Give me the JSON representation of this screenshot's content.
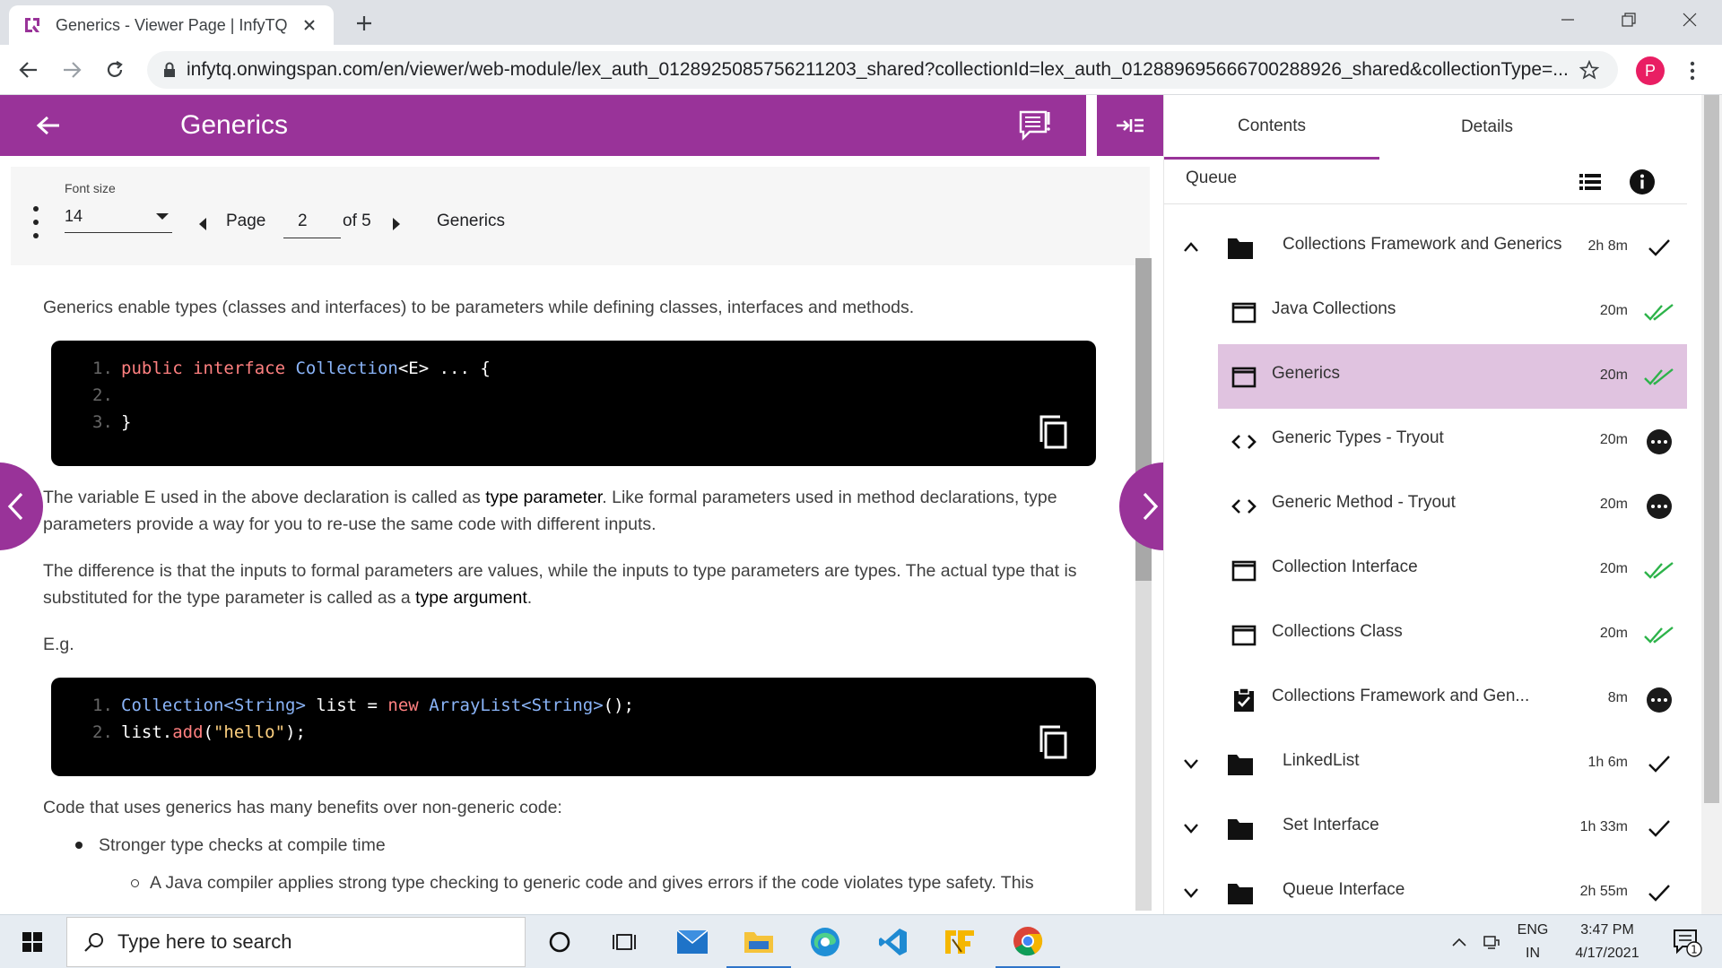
{
  "browser": {
    "tab_title": "Generics - Viewer Page | InfyTQ",
    "url": "infytq.onwingspan.com/en/viewer/web-module/lex_auth_0128925085756211203_shared?collectionId=lex_auth_0128896956667002889​26_shared&collectionType=...",
    "profile_initial": "P"
  },
  "header": {
    "title": "Generics"
  },
  "toolbar": {
    "font_size_label": "Font size",
    "font_size_value": "14",
    "page_label": "Page",
    "page_current": "2",
    "page_of": "of 5",
    "section_title": "Generics"
  },
  "content": {
    "p1": "Generics enable types (classes and interfaces) to be parameters while defining classes, interfaces and methods.",
    "code1": {
      "l1_num": "1.",
      "l1_kw": "public interface ",
      "l1_ty": "Collection",
      "l1_pl": "<E> ... {",
      "l2_num": "2.",
      "l3_num": "3.",
      "l3_pl": "}"
    },
    "p2_a": "The variable E used in the above declaration is called as ",
    "p2_b": "type parameter",
    "p2_c": ". Like formal parameters used in method declarations, type parameters provide a way for you to re-use the same code with different inputs.",
    "p3_a": "The difference is that the inputs to formal parameters are values, while the inputs to type parameters are types. The actual type that is substituted for the type parameter is called as a ",
    "p3_b": "type argument",
    "p3_c": ".",
    "p4": "E.g.",
    "code2": {
      "l1_num": "1.",
      "l1_ty1": "Collection<String>",
      "l1_pl1": " list = ",
      "l1_kw": "new ",
      "l1_ty2": "ArrayList<String>",
      "l1_pl2": "();",
      "l2_num": "2.",
      "l2_pl1": "list.",
      "l2_kw": "add",
      "l2_pl2": "(",
      "l2_st": "\"hello\"",
      "l2_pl3": ");"
    },
    "p5": "Code that uses generics has many benefits over non-generic code:",
    "bullet1": "Stronger type checks at compile time",
    "sub_bullet1": "A Java compiler applies strong type checking to generic code and gives errors if the code violates type safety. This"
  },
  "panel": {
    "tabs": [
      "Contents",
      "Details"
    ],
    "queue_label": "Queue",
    "items": [
      {
        "label": "Collections Framework and Generics",
        "duration": "2h 8m",
        "type": "folder",
        "expanded": true,
        "status": "check"
      },
      {
        "label": "Java Collections",
        "duration": "20m",
        "type": "page",
        "status": "double-check"
      },
      {
        "label": "Generics",
        "duration": "20m",
        "type": "page",
        "status": "double-check",
        "active": true
      },
      {
        "label": "Generic Types - Tryout",
        "duration": "20m",
        "type": "code",
        "status": "more"
      },
      {
        "label": "Generic Method - Tryout",
        "duration": "20m",
        "type": "code",
        "status": "more"
      },
      {
        "label": "Collection Interface",
        "duration": "20m",
        "type": "page",
        "status": "double-check"
      },
      {
        "label": "Collections Class",
        "duration": "20m",
        "type": "page",
        "status": "double-check"
      },
      {
        "label": "Collections Framework and Gen...",
        "duration": "8m",
        "type": "quiz",
        "status": "more"
      },
      {
        "label": "LinkedList",
        "duration": "1h 6m",
        "type": "folder",
        "expanded": false,
        "status": "check"
      },
      {
        "label": "Set Interface",
        "duration": "1h 33m",
        "type": "folder",
        "expanded": false,
        "status": "check"
      },
      {
        "label": "Queue Interface",
        "duration": "2h 55m",
        "type": "folder",
        "expanded": false,
        "status": "check"
      }
    ]
  },
  "taskbar": {
    "search_placeholder": "Type here to search",
    "lang_top": "ENG",
    "lang_bottom": "IN",
    "time": "3:47 PM",
    "date": "4/17/2021",
    "notification_count": "1"
  },
  "colors": {
    "accent": "#993399",
    "active_row": "#e0c3e0",
    "check_green": "#2db34a"
  }
}
